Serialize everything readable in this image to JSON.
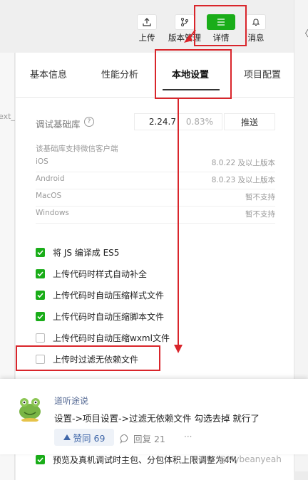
{
  "toolbar": {
    "upload_label": "上传",
    "version_label": "版本管理",
    "detail_label": "详情",
    "message_label": "消息"
  },
  "left_strip": {
    "fragment": "ext_"
  },
  "right_strip": {
    "fragment": "〈"
  },
  "tabs": [
    {
      "label": "基本信息"
    },
    {
      "label": "性能分析"
    },
    {
      "label": "本地设置"
    },
    {
      "label": "项目配置"
    }
  ],
  "debug_lib": {
    "label": "调试基础库",
    "help_icon": "question-circle-icon",
    "version": "2.24.7",
    "percent": "0.83%",
    "push_label": "推送",
    "support_note": "该基础库支持微信客户端"
  },
  "env_support": [
    {
      "platform": "iOS",
      "status": "8.0.22 及以上版本"
    },
    {
      "platform": "Android",
      "status": "8.0.23 及以上版本"
    },
    {
      "platform": "MacOS",
      "status": "暂不支持"
    },
    {
      "platform": "Windows",
      "status": "暂不支持"
    }
  ],
  "options": [
    {
      "label": "将 JS 编译成 ES5",
      "checked": true
    },
    {
      "label": "上传代码时样式自动补全",
      "checked": true
    },
    {
      "label": "上传代码时自动压缩样式文件",
      "checked": true
    },
    {
      "label": "上传代码时自动压缩脚本文件",
      "checked": true
    },
    {
      "label": "上传代码时自动压缩wxml文件",
      "checked": false
    },
    {
      "label": "上传时过滤无依赖文件",
      "checked": false
    }
  ],
  "comment": {
    "author": "道听途说",
    "text": "设置->项目设置->过滤无依赖文件 勾选去掉 就行了",
    "like_label": "赞同 69",
    "reply_label": "回复 21",
    "more": "···"
  },
  "bottom_partial": {
    "text": "预览及真机调试时主包、分包体积上限调整为4M"
  },
  "watermark": {
    "text": "@Mybeanyeah"
  },
  "colors": {
    "accent": "#1aad19",
    "annotation": "#d9252b",
    "link": "#576b95"
  }
}
